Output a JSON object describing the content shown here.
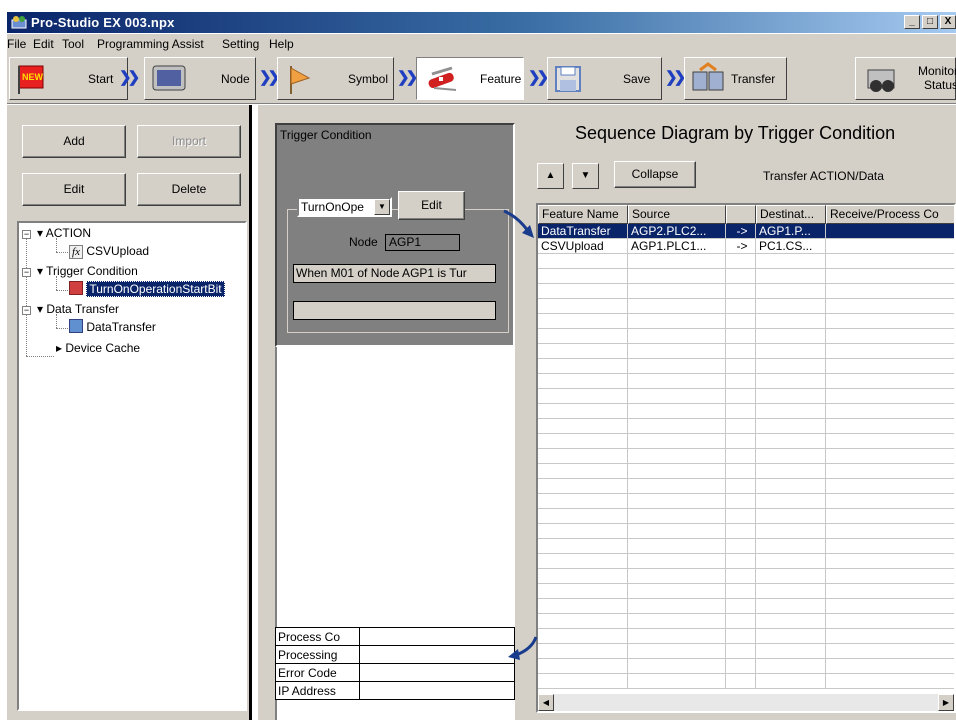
{
  "window": {
    "title": "Pro-Studio EX   003.npx",
    "controls": [
      "_",
      "□",
      "X"
    ]
  },
  "menu": [
    "File",
    "Edit",
    "Tool",
    "Programming Assist",
    "Setting",
    "Help"
  ],
  "toolbar": {
    "steps": [
      {
        "label": "Start",
        "icon": "new-flag-icon"
      },
      {
        "label": "Node",
        "icon": "monitor-icon"
      },
      {
        "label": "Symbol",
        "icon": "flag-icon"
      },
      {
        "label": "Feature",
        "icon": "swiss-knife-icon"
      },
      {
        "label": "Save",
        "icon": "floppy-icon"
      },
      {
        "label": "Transfer",
        "icon": "transfer-icon"
      }
    ],
    "monitor": {
      "line1": "Monitor",
      "line2": "Status"
    }
  },
  "left": {
    "add": "Add",
    "import": "Import",
    "edit": "Edit",
    "delete": "Delete",
    "tree": {
      "action": "ACTION",
      "csv": "CSVUpload",
      "trigger": "Trigger Condition",
      "turnon": "TurnOnOperationStartBit",
      "data_transfer": "Data Transfer",
      "data_transfer_item": "DataTransfer",
      "device_cache": "Device Cache"
    }
  },
  "middle": {
    "trigger_title": "Trigger Condition",
    "combo_value": "TurnOnOpe",
    "edit": "Edit",
    "node_label": "Node",
    "node_value": "AGP1",
    "when_text": "When M01  of Node AGP1  is Tur",
    "status": [
      {
        "key": "Process Co",
        "value": ""
      },
      {
        "key": "Processing",
        "value": ""
      },
      {
        "key": "Error Code",
        "value": ""
      },
      {
        "key": "IP Address",
        "value": ""
      }
    ]
  },
  "right": {
    "title": "Sequence Diagram by Trigger Condition",
    "collapse": "Collapse",
    "transfer_label": "Transfer ACTION/Data",
    "columns": [
      "Feature Name",
      "Source",
      "",
      "Destinat...",
      "Receive/Process Co"
    ],
    "rows": [
      [
        "DataTransfer",
        "AGP2.PLC2...",
        "->",
        "AGP1.P...",
        ""
      ],
      [
        "CSVUpload",
        "AGP1.PLC1...",
        "->",
        "PC1.CS...",
        ""
      ]
    ]
  }
}
